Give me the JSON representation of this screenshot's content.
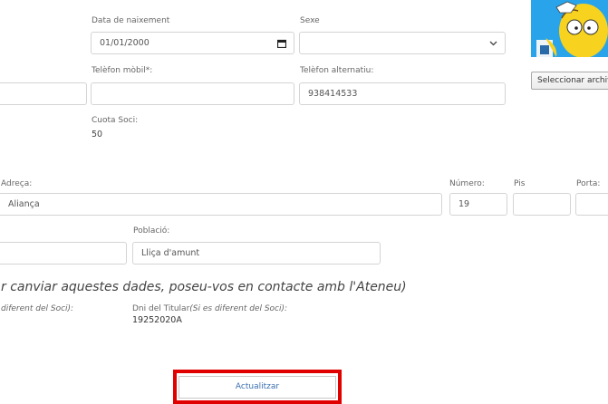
{
  "fields": {
    "birth_date": {
      "label": "Data de naixement",
      "value": "01/01/2000"
    },
    "sex": {
      "label": "Sexe",
      "value": ""
    },
    "mobile": {
      "label": "Telèfon mòbil*:",
      "value": ""
    },
    "alt_phone": {
      "label": "Telèfon alternatiu:",
      "value": "938414533"
    },
    "fee": {
      "label": "Cuota Soci:",
      "value": "50"
    },
    "address": {
      "label": "Adreça:",
      "value": "Aliança"
    },
    "number": {
      "label": "Número:",
      "value": "19"
    },
    "floor": {
      "label": "Pis",
      "value": ""
    },
    "door": {
      "label": "Porta:",
      "value": ""
    },
    "population": {
      "label": "Població:",
      "value": "Lliça d'amunt"
    },
    "left_input": {
      "value": ""
    },
    "postal_input": {
      "value": ""
    }
  },
  "file": {
    "button_label": "Seleccionar archivo"
  },
  "notice": "r canviar aquestes dades, poseu-vos en contacte amb l'Ateneu)",
  "holder": {
    "left_label": "diferent del Soci):",
    "dni_label": "Dni del Titular",
    "dni_note": "(Si es diferent del Soci):",
    "dni_value": "19252020A"
  },
  "actions": {
    "update_label": "Actualitzar"
  },
  "icons": {
    "calendar": "calendar-icon",
    "dropdown": "chevron-down-icon",
    "avatar": "homer-avatar"
  },
  "colors": {
    "highlight": "#e00000",
    "button_text": "#3a6fb0"
  }
}
